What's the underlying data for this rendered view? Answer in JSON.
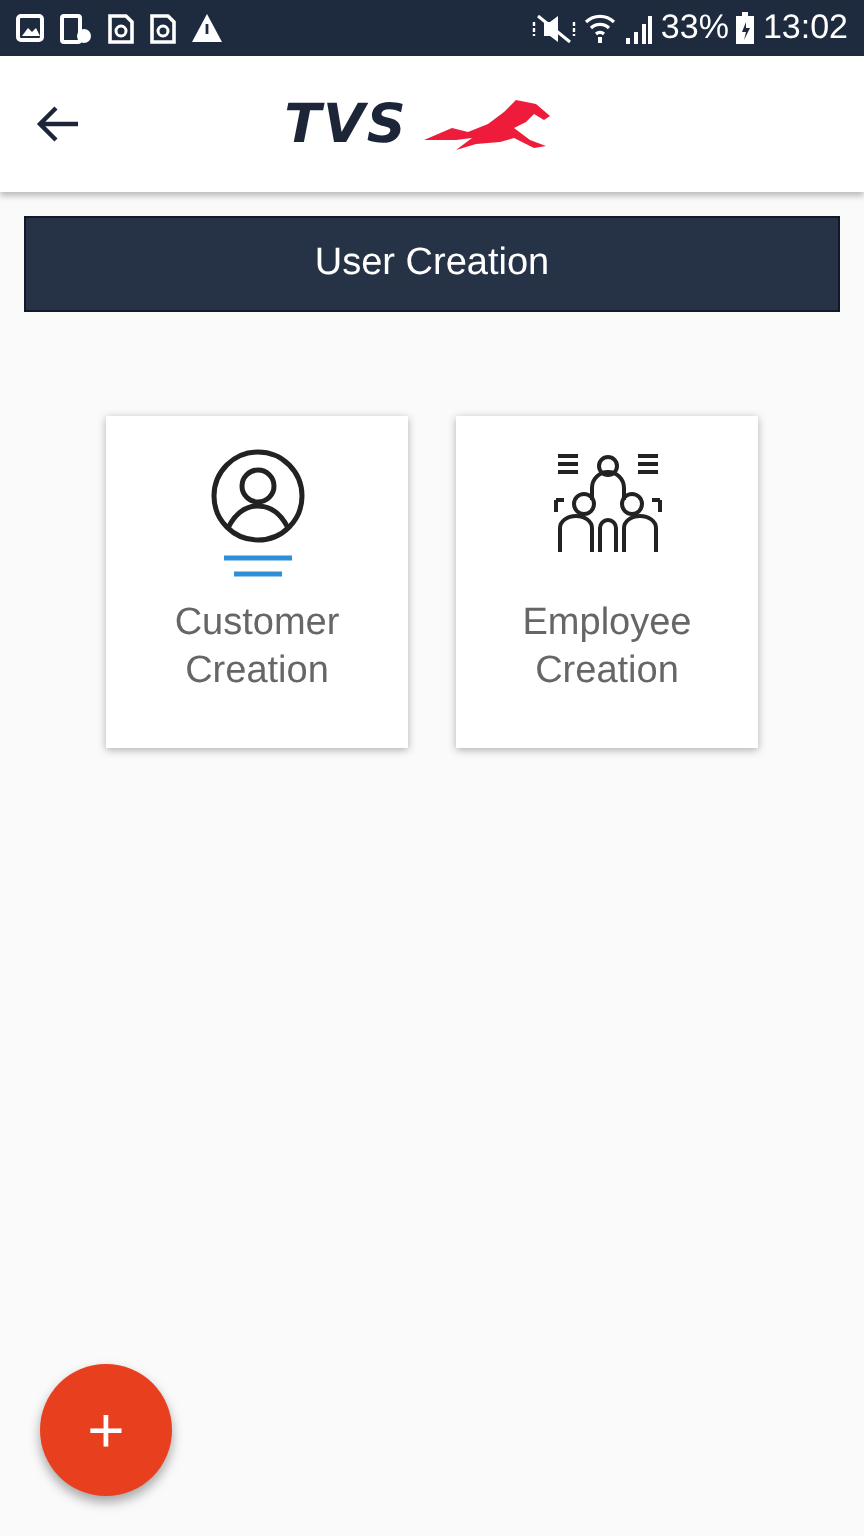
{
  "status_bar": {
    "battery": "33%",
    "time": "13:02"
  },
  "app_bar": {
    "logo": "TVS"
  },
  "header": {
    "title": "User Creation"
  },
  "cards": [
    {
      "kind": "customer",
      "lines": [
        "Customer",
        "Creation"
      ]
    },
    {
      "kind": "employee",
      "lines": [
        "Employee",
        "Creation"
      ]
    }
  ],
  "fab": {
    "label": "+"
  }
}
